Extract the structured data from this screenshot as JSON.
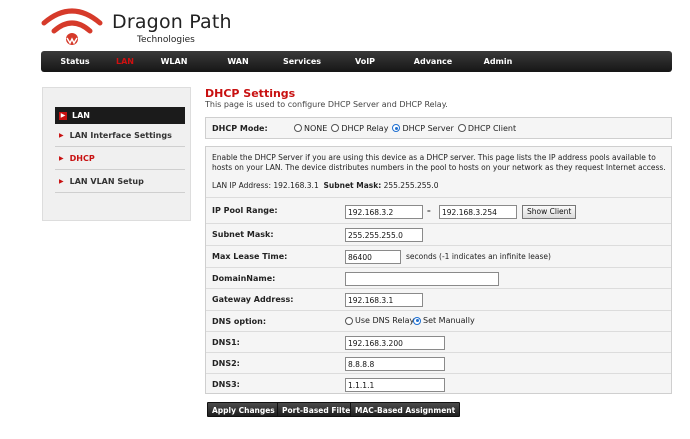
{
  "brand": {
    "name": "Dragon Path",
    "subtitle": "Technologies",
    "accent": "#d63a2a"
  },
  "nav": [
    "Status",
    "LAN",
    "WLAN",
    "WAN",
    "Services",
    "VoIP",
    "Advance",
    "Admin"
  ],
  "sidebar": {
    "header": "LAN",
    "items": [
      {
        "label": "LAN Interface Settings"
      },
      {
        "label": "DHCP"
      },
      {
        "label": "LAN VLAN Setup"
      }
    ]
  },
  "page": {
    "title": "DHCP Settings",
    "subtitle": "This page is used to configure DHCP Server and DHCP Relay."
  },
  "mode": {
    "label": "DHCP Mode:",
    "options": [
      "NONE",
      "DHCP Relay",
      "DHCP Server",
      "DHCP Client"
    ],
    "selected": "DHCP Server"
  },
  "description": "Enable the DHCP Server if you are using this device as a DHCP server. This page lists the IP address pools available to hosts on your LAN. The device distributes numbers in the pool to hosts on your network as they request Internet access.",
  "lan_info": {
    "ip_label": "LAN IP Address:",
    "ip_value": "192.168.3.1",
    "mask_label": "Subnet Mask:",
    "mask_value": "255.255.255.0"
  },
  "form": {
    "pool_label": "IP Pool Range:",
    "pool_start": "192.168.3.2",
    "pool_dash": "–",
    "pool_end": "192.168.3.254",
    "show_client": "Show Client",
    "subnet_label": "Subnet Mask:",
    "subnet_value": "255.255.255.0",
    "lease_label": "Max Lease Time:",
    "lease_value": "86400",
    "lease_note": "seconds (-1 indicates an infinite lease)",
    "domain_label": "DomainName:",
    "domain_value": "",
    "gateway_label": "Gateway Address:",
    "gateway_value": "192.168.3.1",
    "dns_option_label": "DNS option:",
    "dns_options": [
      "Use DNS Relay",
      "Set Manually"
    ],
    "dns_selected": "Set Manually",
    "dns1_label": "DNS1:",
    "dns1_value": "192.168.3.200",
    "dns2_label": "DNS2:",
    "dns2_value": "8.8.8.8",
    "dns3_label": "DNS3:",
    "dns3_value": "1.1.1.1"
  },
  "actions": [
    "Apply Changes",
    "Port-Based Filter",
    "MAC-Based Assignment"
  ]
}
